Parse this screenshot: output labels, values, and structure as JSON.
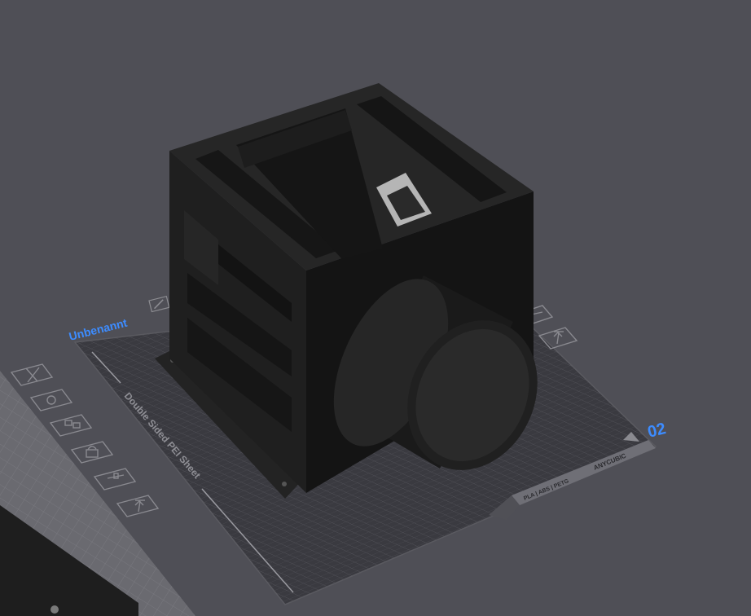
{
  "plate": {
    "name": "Unbenannt",
    "number": "02",
    "sheet_label": "Double Sided PEI Sheet",
    "material_label": "PLA | ABS | PETG",
    "brand_label": "ANYCUBIC"
  },
  "plate_tools": [
    {
      "name": "delete-plate-icon"
    },
    {
      "name": "auto-orient-icon"
    },
    {
      "name": "arrange-icon"
    },
    {
      "name": "lock-plate-icon"
    },
    {
      "name": "plate-settings-icon"
    },
    {
      "name": "move-to-top-icon"
    }
  ],
  "colors": {
    "background": "#4f4f56",
    "plate": "#3a3a40",
    "model": "#1c1c1c",
    "accent": "#3d8cff"
  }
}
